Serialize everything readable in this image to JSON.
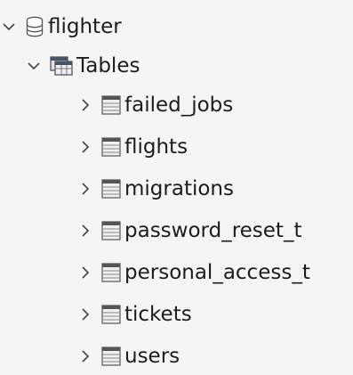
{
  "tree": {
    "database": {
      "label": "flighter",
      "icon": "database-icon",
      "expanded": true
    },
    "folder": {
      "label": "Tables",
      "icon": "tables-folder-icon",
      "expanded": true
    },
    "tables": [
      {
        "label": "failed_jobs",
        "icon": "table-icon",
        "expanded": false
      },
      {
        "label": "flights",
        "icon": "table-icon",
        "expanded": false
      },
      {
        "label": "migrations",
        "icon": "table-icon",
        "expanded": false
      },
      {
        "label": "password_reset_t",
        "icon": "table-icon",
        "expanded": false
      },
      {
        "label": "personal_access_t",
        "icon": "table-icon",
        "expanded": false
      },
      {
        "label": "tickets",
        "icon": "table-icon",
        "expanded": false
      },
      {
        "label": "users",
        "icon": "table-icon",
        "expanded": false
      }
    ]
  }
}
